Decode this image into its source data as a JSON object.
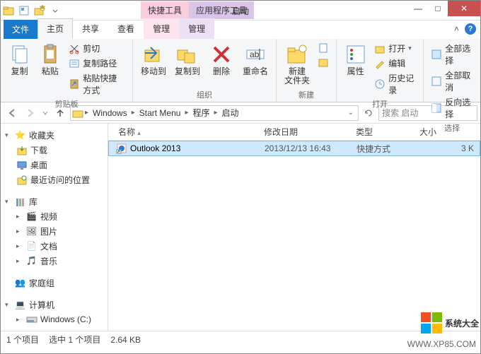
{
  "window": {
    "title": "启动",
    "context_tabs": [
      "快捷工具",
      "应用程序工具"
    ],
    "controls": {
      "min": "—",
      "max": "□",
      "close": "✕"
    }
  },
  "ribbon": {
    "tabs": {
      "file": "文件",
      "home": "主页",
      "share": "共享",
      "view": "查看",
      "manage1": "管理",
      "manage2": "管理"
    },
    "groups": {
      "clipboard": {
        "label": "剪贴板",
        "copy": "复制",
        "paste": "粘贴",
        "cut": "剪切",
        "copy_path": "复制路径",
        "paste_shortcut": "粘贴快捷方式"
      },
      "organize": {
        "label": "组织",
        "move_to": "移动到",
        "copy_to": "复制到",
        "delete": "删除",
        "rename": "重命名"
      },
      "new": {
        "label": "新建",
        "new_folder": "新建\n文件夹"
      },
      "open": {
        "label": "打开",
        "properties": "属性",
        "open": "打开",
        "edit": "编辑",
        "history": "历史记录"
      },
      "select": {
        "label": "选择",
        "select_all": "全部选择",
        "select_none": "全部取消",
        "invert": "反向选择"
      }
    }
  },
  "nav": {
    "crumbs": [
      "Windows",
      "Start Menu",
      "程序",
      "启动"
    ],
    "search_placeholder": "搜索 启动"
  },
  "sidebar": {
    "fav_head": "收藏夹",
    "fav_items": [
      "下载",
      "桌面",
      "最近访问的位置"
    ],
    "lib_head": "库",
    "lib_items": [
      "视频",
      "图片",
      "文档",
      "音乐"
    ],
    "homegroup": "家庭组",
    "computer": "计算机",
    "drive": "Windows (C:)"
  },
  "columns": {
    "name": "名称",
    "date": "修改日期",
    "type": "类型",
    "size": "大小"
  },
  "file": {
    "name": "Outlook 2013",
    "date": "2013/12/13  16:43",
    "type": "快捷方式",
    "size": "3 K"
  },
  "status": {
    "count": "1 个项目",
    "selected": "选中 1 个项目",
    "size": "2.64 KB"
  },
  "brand": {
    "text": "系统大全",
    "url": "WWW.XP85.COM"
  }
}
